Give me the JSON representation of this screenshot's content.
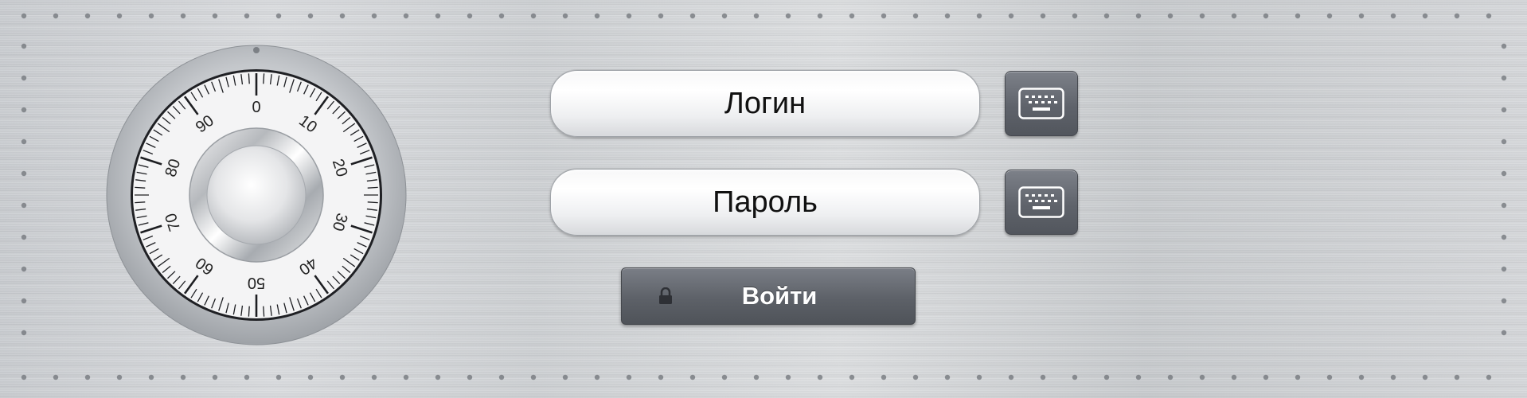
{
  "login": {
    "placeholder": "Логин"
  },
  "password": {
    "placeholder": "Пароль"
  },
  "submit": {
    "label": "Войти"
  },
  "dial": {
    "numbers": [
      "0",
      "10",
      "20",
      "30",
      "40",
      "50",
      "60",
      "70",
      "80",
      "90"
    ]
  },
  "icons": {
    "keyboard_login": "keyboard-icon",
    "keyboard_password": "keyboard-icon",
    "lock": "lock-icon"
  },
  "colors": {
    "metal": "#d2d4d7",
    "button_dark": "#5d6168",
    "field_light": "#ffffff",
    "text_dark": "#111111",
    "text_light": "#ffffff"
  }
}
